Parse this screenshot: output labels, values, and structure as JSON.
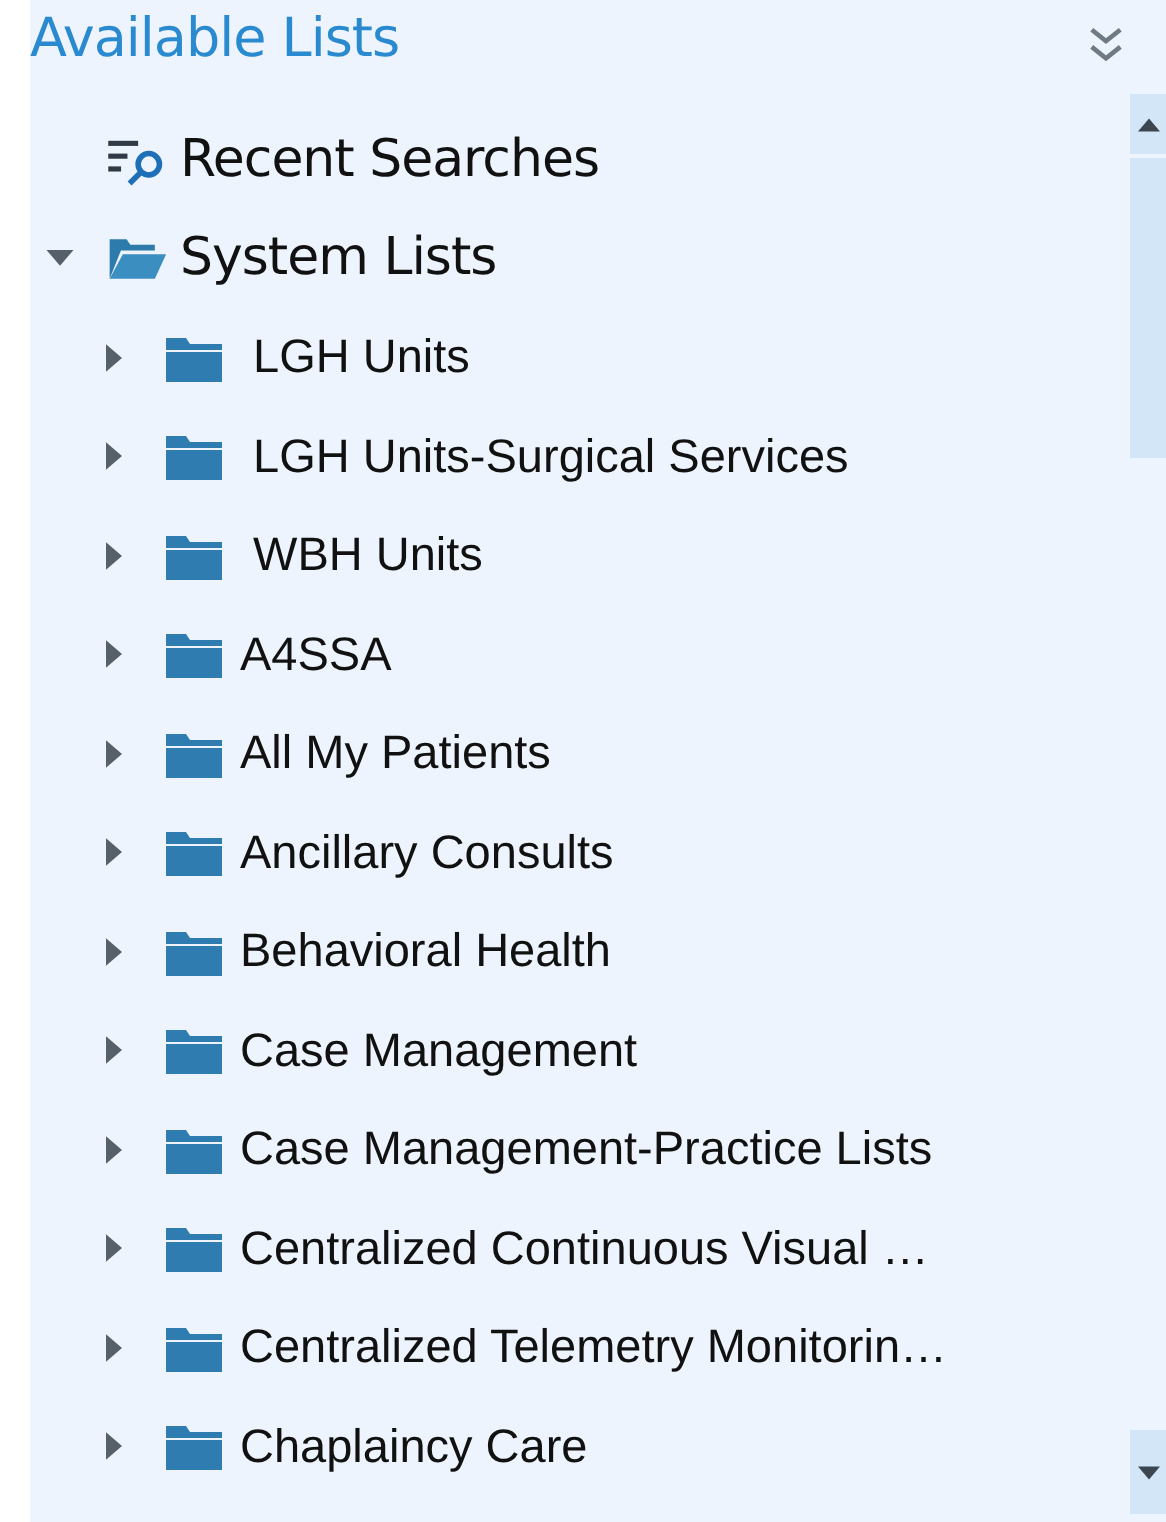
{
  "title": "Available Lists",
  "tree": [
    {
      "kind": "search",
      "label": "Recent Searches"
    },
    {
      "kind": "folder",
      "label": "System Lists",
      "expanded": true,
      "children": [
        {
          "kind": "folder",
          "label": " LGH Units",
          "expanded": false
        },
        {
          "kind": "folder",
          "label": " LGH Units-Surgical Services",
          "expanded": false
        },
        {
          "kind": "folder",
          "label": " WBH Units",
          "expanded": false
        },
        {
          "kind": "folder",
          "label": "A4SSA",
          "expanded": false
        },
        {
          "kind": "folder",
          "label": "All My Patients",
          "expanded": false
        },
        {
          "kind": "folder",
          "label": "Ancillary Consults",
          "expanded": false
        },
        {
          "kind": "folder",
          "label": "Behavioral Health",
          "expanded": false
        },
        {
          "kind": "folder",
          "label": "Case Management",
          "expanded": false
        },
        {
          "kind": "folder",
          "label": "Case Management-Practice Lists",
          "expanded": false
        },
        {
          "kind": "folder",
          "label": "Centralized Continuous Visual …",
          "expanded": false
        },
        {
          "kind": "folder",
          "label": "Centralized Telemetry Monitorin…",
          "expanded": false
        },
        {
          "kind": "folder",
          "label": "Chaplaincy Care",
          "expanded": false
        }
      ]
    }
  ]
}
